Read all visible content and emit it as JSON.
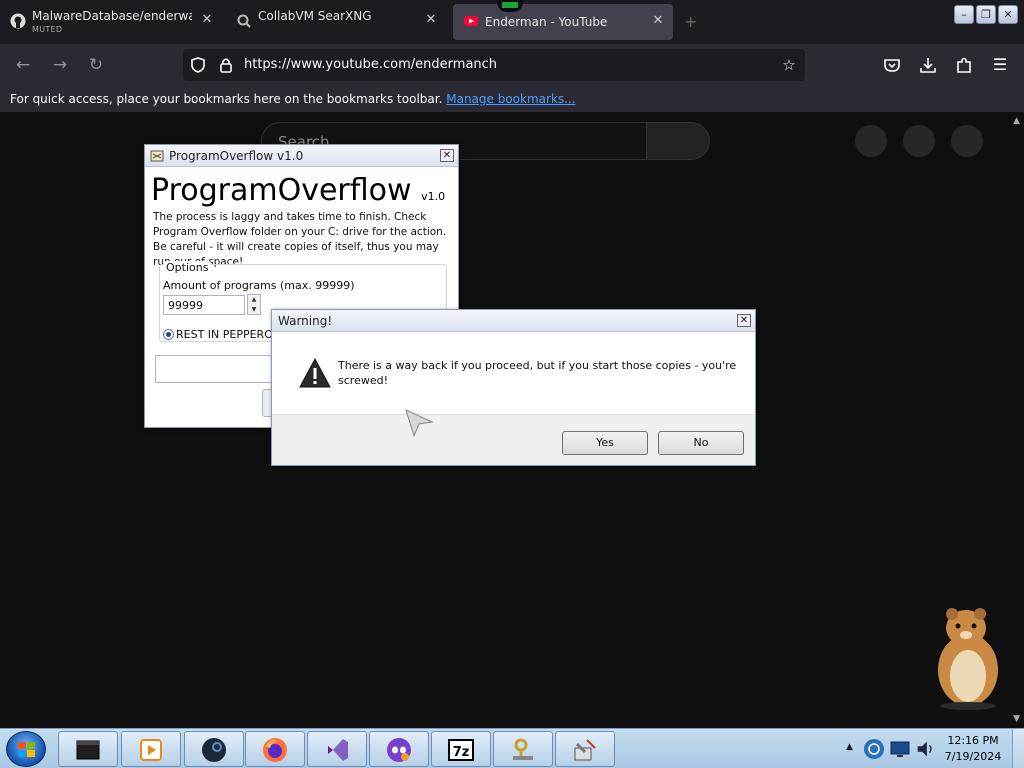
{
  "browser": {
    "tabs": [
      {
        "title": "MalwareDatabase/enderware/U",
        "subtitle": "MUTED",
        "icon": "github-icon"
      },
      {
        "title": "CollabVM SearXNG",
        "subtitle": "",
        "icon": "searxng-icon"
      },
      {
        "title": "Enderman - YouTube",
        "subtitle": "",
        "icon": "youtube-icon",
        "active": true
      }
    ],
    "url": "https://www.youtube.com/endermanch",
    "bookmarks_hint": "For quick access, place your bookmarks here on the bookmarks toolbar.",
    "bookmarks_link": "Manage bookmarks..."
  },
  "page": {
    "search_placeholder": "Search"
  },
  "program_overflow": {
    "window_title": "ProgramOverflow v1.0",
    "heading": "ProgramOverflow",
    "version": "v1.0",
    "description": "The process is laggy and takes time to finish. Check Program Overflow folder on your C: drive for the action. Be careful - it will create copies of itself, thus you may run our of space!",
    "options_legend": "Options",
    "amount_label": "Amount of programs (max. 99999)",
    "amount_value": "99999",
    "radio_label": "REST IN PEPPERONI"
  },
  "warning": {
    "title": "Warning!",
    "message": "There is a way back if you proceed, but if you start those copies - you're screwed!",
    "yes_label": "Yes",
    "no_label": "No"
  },
  "taskbar": {
    "apps": [
      "terminal-icon",
      "media-player-icon",
      "steam-icon",
      "firefox-icon",
      "visual-studio-icon",
      "discord-icon",
      "7zip-icon",
      "keys-icon",
      "tools-icon"
    ],
    "time": "12:16 PM",
    "date": "7/19/2024"
  }
}
